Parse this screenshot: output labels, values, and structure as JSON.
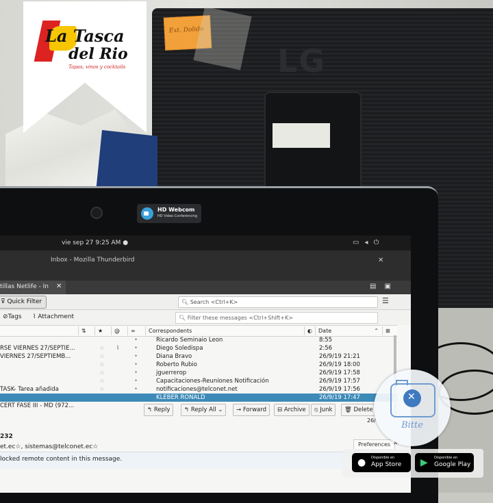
{
  "logo": {
    "line1": "La Tasca",
    "line2": "del Rio",
    "tagline": "Tapas, vinos y cocktails"
  },
  "webcam_badge": {
    "title": "HD Webcom",
    "subtitle": "HD Video Conferencing"
  },
  "monitor_brand": "LG",
  "sticky_note": "Ext. Dolido",
  "system_bar": {
    "clock": "vie sep 27   9:25 AM ●"
  },
  "window": {
    "title": "Inbox - Mozilla Thunderbird"
  },
  "tab": {
    "label": "tillas Netlife - In"
  },
  "toolbar": {
    "quick_filter": "Quick Filter",
    "search_placeholder": "Search <Ctrl+K>",
    "filter_placeholder": "Filter these messages <Ctrl+Shift+K>",
    "tags": "Tags",
    "attachment": "Attachment"
  },
  "columns": {
    "correspondents": "Correspondents",
    "date": "Date"
  },
  "messages": [
    {
      "subject": "",
      "from": "Ricardo Seminaio Leon",
      "date": "8:55"
    },
    {
      "subject": "RSE VIERNES 27/SEPTIE...",
      "from": "Diego Soledispa",
      "date": "2:56"
    },
    {
      "subject": "VIERNES 27/SEPTIEMB...",
      "from": "Diana Bravo",
      "date": "26/9/19 21:21"
    },
    {
      "subject": "",
      "from": "Roberto Rubio",
      "date": "26/9/19 18:00"
    },
    {
      "subject": "",
      "from": "jguerrerop",
      "date": "26/9/19 17:58"
    },
    {
      "subject": "",
      "from": "Capacitaciones-Reuniones Notificación",
      "date": "26/9/19 17:57"
    },
    {
      "subject": "TASK- Tarea añadida",
      "from": "notificaciones@telconet.net",
      "date": "26/9/19 17:56"
    },
    {
      "subject": "",
      "from": "KLEBER RONALD",
      "date": "26/9/19 17:47"
    },
    {
      "subject": "CERT FASE III - MD (972...",
      "from": "",
      "date": ""
    }
  ],
  "message_actions": {
    "reply": "Reply",
    "reply_all": "Reply All",
    "forward": "Forward",
    "archive": "Archive",
    "junk": "Junk",
    "delete": "Delete",
    "date_partial": "26/"
  },
  "message_pane": {
    "id_fragment": "232",
    "recipients": "et.ec☆, sistemas@telconet.ec☆",
    "preferences": "Preferences",
    "remote_content": "locked remote content in this message."
  },
  "bitte": {
    "label": "Bitte"
  },
  "stores": {
    "app_store_sub": "Disponible en",
    "app_store": "App Store",
    "google_play_sub": "Disponible en",
    "google_play": "Google Play"
  }
}
